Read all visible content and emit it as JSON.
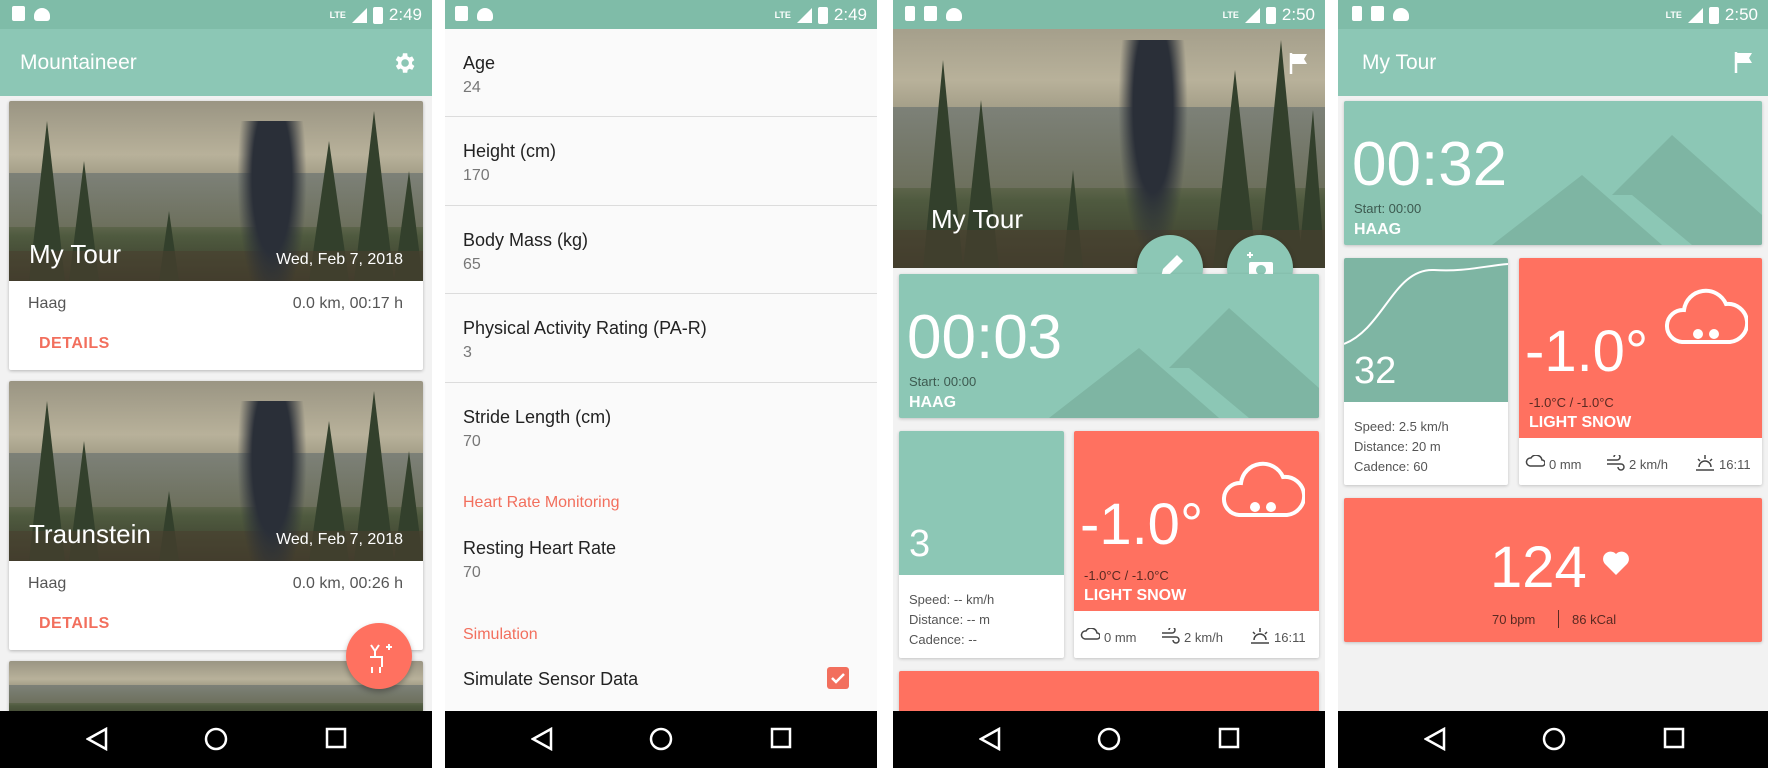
{
  "status": {
    "time1": "2:49",
    "time2": "2:49",
    "time3": "2:50",
    "time4": "2:50",
    "lte": "LTE"
  },
  "screen1": {
    "title": "Mountaineer",
    "cards": [
      {
        "title": "My Tour",
        "date": "Wed, Feb 7, 2018",
        "place": "Haag",
        "stats": "0.0 km, 00:17 h",
        "action": "DETAILS"
      },
      {
        "title": "Traunstein",
        "date": "Wed, Feb 7, 2018",
        "place": "Haag",
        "stats": "0.0 km, 00:26 h",
        "action": "DETAILS"
      }
    ]
  },
  "screen2": {
    "prefs": [
      {
        "label": "Age",
        "value": "24"
      },
      {
        "label": "Height (cm)",
        "value": "170"
      },
      {
        "label": "Body Mass (kg)",
        "value": "65"
      },
      {
        "label": "Physical Activity Rating (PA-R)",
        "value": "3"
      },
      {
        "label": "Stride Length (cm)",
        "value": "70"
      }
    ],
    "section_hr": "Heart Rate Monitoring",
    "resting_label": "Resting Heart Rate",
    "resting_value": "70",
    "section_sim": "Simulation",
    "simulate_label": "Simulate Sensor Data",
    "simulate_checked": true
  },
  "screen3": {
    "title": "My Tour",
    "timer": "00:03",
    "start": "Start: 00:00",
    "place": "HAAG",
    "steps": "3",
    "speed": "Speed: -- km/h",
    "distance": "Distance: -- m",
    "cadence": "Cadence: --",
    "temp": "-1.0°",
    "range": "-1.0°C / -1.0°C",
    "cond": "LIGHT SNOW",
    "rain": "0 mm",
    "wind": "2 km/h",
    "sunset": "16:11"
  },
  "screen4": {
    "title": "My Tour",
    "timer": "00:32",
    "start": "Start: 00:00",
    "place": "HAAG",
    "steps": "32",
    "speed": "Speed: 2.5 km/h",
    "distance": "Distance: 20 m",
    "cadence": "Cadence: 60",
    "temp": "-1.0°",
    "range": "-1.0°C / -1.0°C",
    "cond": "LIGHT SNOW",
    "rain": "0 mm",
    "wind": "2 km/h",
    "sunset": "16:11",
    "heart": "124",
    "bpm": "70 bpm",
    "kcal": "86 kCal"
  },
  "colors": {
    "teal": "#8cc7b5",
    "status": "#7fbca8",
    "coral": "#ff7160",
    "accent": "#f26f5d"
  }
}
